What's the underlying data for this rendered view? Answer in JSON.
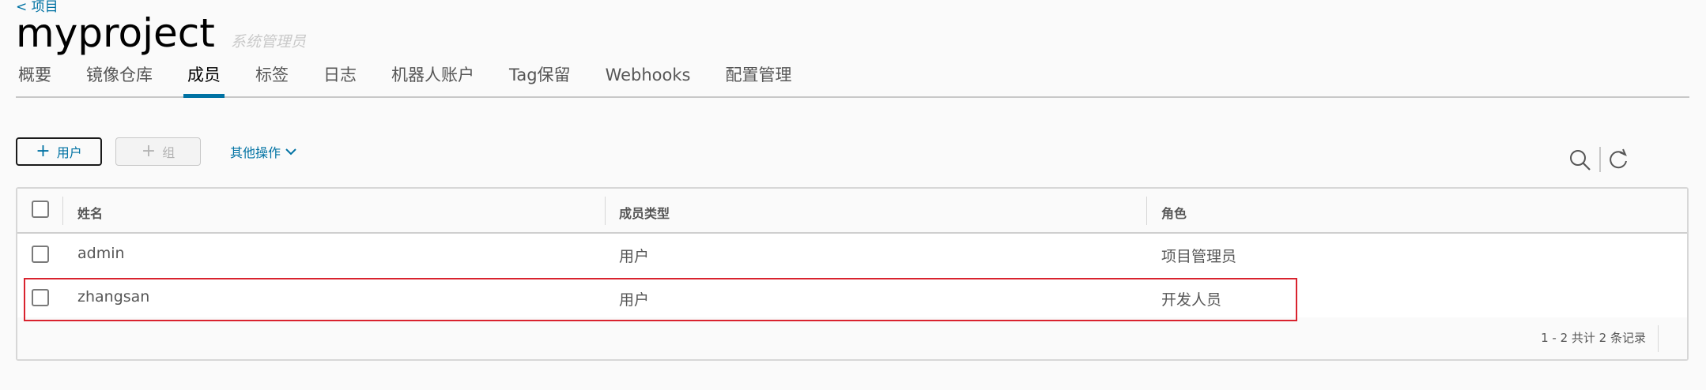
{
  "back_link": "< 项目",
  "project": {
    "name": "myproject",
    "role": "系统管理员"
  },
  "tabs": [
    "概要",
    "镜像仓库",
    "成员",
    "标签",
    "日志",
    "机器人账户",
    "Tag保留",
    "Webhooks",
    "配置管理"
  ],
  "active_tab": "成员",
  "toolbar": {
    "add_user": "用户",
    "add_group": "组",
    "more_actions": "其他操作"
  },
  "table": {
    "columns": [
      "姓名",
      "成员类型",
      "角色"
    ],
    "rows": [
      {
        "name": "admin",
        "type": "用户",
        "role": "项目管理员"
      },
      {
        "name": "zhangsan",
        "type": "用户",
        "role": "开发人员"
      }
    ],
    "pagination": "1 - 2 共计 2 条记录"
  },
  "colors": {
    "accent": "#0072a3",
    "highlight": "#d9232e"
  },
  "icons": [
    "plus-icon",
    "chevron-down-icon",
    "search-icon",
    "refresh-icon"
  ]
}
